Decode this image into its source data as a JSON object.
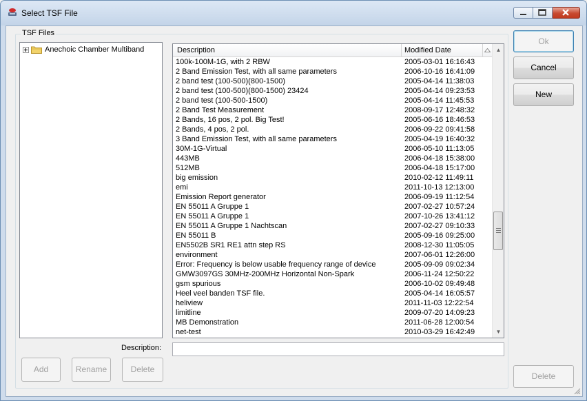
{
  "window": {
    "title": "Select TSF File",
    "icon": "app-icon"
  },
  "group": {
    "label": "TSF Files"
  },
  "tree": {
    "nodes": [
      {
        "label": "Anechoic Chamber Multiband",
        "icon": "folder-icon"
      }
    ]
  },
  "list": {
    "columns": [
      "Description",
      "Modified Date"
    ],
    "rows": [
      {
        "description": "100k-100M-1G, with 2 RBW",
        "date": "2005-03-01 16:16:43"
      },
      {
        "description": "2 Band Emission Test, with all same parameters",
        "date": "2006-10-16 16:41:09"
      },
      {
        "description": "2 band test (100-500)(800-1500)",
        "date": "2005-04-14 11:38:03"
      },
      {
        "description": "2 band test (100-500)(800-1500) 23424",
        "date": "2005-04-14 09:23:53"
      },
      {
        "description": "2 band test (100-500-1500)",
        "date": "2005-04-14 11:45:53"
      },
      {
        "description": "2 Band Test Measurement",
        "date": "2008-09-17 12:48:32"
      },
      {
        "description": "2 Bands, 16 pos, 2 pol. Big Test!",
        "date": "2005-06-16 18:46:53"
      },
      {
        "description": "2 Bands, 4 pos, 2 pol.",
        "date": "2006-09-22 09:41:58"
      },
      {
        "description": "3 Band Emission Test, with all same parameters",
        "date": "2005-04-19 16:40:32"
      },
      {
        "description": "30M-1G-Virtual",
        "date": "2006-05-10 11:13:05"
      },
      {
        "description": "443MB",
        "date": "2006-04-18 15:38:00"
      },
      {
        "description": "512MB",
        "date": "2006-04-18 15:17:00"
      },
      {
        "description": "big emission",
        "date": "2010-02-12 11:49:11"
      },
      {
        "description": "emi",
        "date": "2011-10-13 12:13:00"
      },
      {
        "description": "Emission Report generator",
        "date": "2006-09-19 11:12:54"
      },
      {
        "description": "EN 55011 A Gruppe 1",
        "date": "2007-02-27 10:57:24"
      },
      {
        "description": "EN 55011 A Gruppe 1",
        "date": "2007-10-26 13:41:12"
      },
      {
        "description": "EN 55011 A Gruppe 1 Nachtscan",
        "date": "2007-02-27 09:10:33"
      },
      {
        "description": "EN 55011 B",
        "date": "2005-09-16 09:25:00"
      },
      {
        "description": "EN5502B SR1 RE1 attn step RS",
        "date": "2008-12-30 11:05:05"
      },
      {
        "description": "environment",
        "date": "2007-06-01 12:26:00"
      },
      {
        "description": "Error: Frequency is below usable frequency range of device",
        "date": "2005-09-09 09:02:34"
      },
      {
        "description": "GMW3097GS 30MHz-200MHz Horizontal Non-Spark",
        "date": "2006-11-24 12:50:22"
      },
      {
        "description": "gsm spurious",
        "date": "2006-10-02 09:49:48"
      },
      {
        "description": "Heel veel banden TSF file.",
        "date": "2005-04-14 16:05:57"
      },
      {
        "description": "heliview",
        "date": "2011-11-03 12:22:54"
      },
      {
        "description": "limitline",
        "date": "2009-07-20 14:09:23"
      },
      {
        "description": "MB Demonstration",
        "date": "2011-06-28 12:00:54"
      },
      {
        "description": "net-test",
        "date": "2010-03-29 16:42:49"
      }
    ]
  },
  "description_field": {
    "label": "Description:",
    "value": ""
  },
  "buttons": {
    "ok": "Ok",
    "cancel": "Cancel",
    "new": "New",
    "add": "Add",
    "rename": "Rename",
    "delete_left": "Delete",
    "delete_right": "Delete"
  },
  "colors": {
    "titlebar": "#c3d4e8",
    "close_button": "#c84a31",
    "default_button_border": "#3c7fb1"
  }
}
